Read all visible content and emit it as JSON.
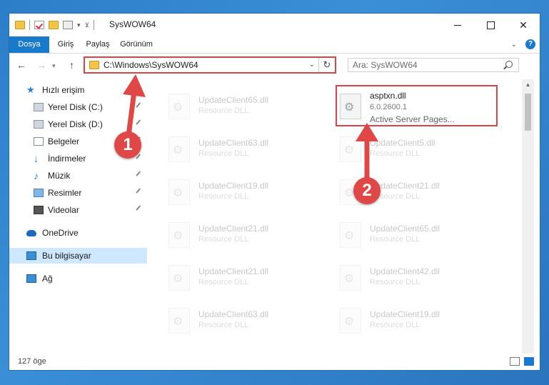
{
  "window": {
    "title": "SysWOW64"
  },
  "ribbon": {
    "tabs": [
      {
        "label": "Dosya"
      },
      {
        "label": "Giriş"
      },
      {
        "label": "Paylaş"
      },
      {
        "label": "Görünüm"
      }
    ],
    "help_label": "?"
  },
  "navbar": {
    "address": "C:\\Windows\\SysWOW64",
    "search_placeholder": "Ara: SysWOW64"
  },
  "navpane": {
    "quick_access": "Hızlı erişim",
    "items": [
      {
        "label": "Yerel Disk (C:)",
        "icon": "drive-icon",
        "pinned": true
      },
      {
        "label": "Yerel Disk (D:)",
        "icon": "drive-icon",
        "pinned": true
      },
      {
        "label": "Belgeler",
        "icon": "documents-icon",
        "pinned": true
      },
      {
        "label": "İndirmeler",
        "icon": "download-icon",
        "pinned": true
      },
      {
        "label": "Müzik",
        "icon": "music-icon",
        "pinned": true
      },
      {
        "label": "Resimler",
        "icon": "pictures-icon",
        "pinned": true
      },
      {
        "label": "Videolar",
        "icon": "videos-icon",
        "pinned": true
      }
    ],
    "onedrive": "OneDrive",
    "this_pc": "Bu bilgisayar",
    "network": "Ağ"
  },
  "files": {
    "highlighted": {
      "name": "asptxn.dll",
      "version": "6.0.2600.1",
      "description": "Active Server Pages..."
    },
    "left_column": [
      {
        "name": "UpdateClient65.dll",
        "type": "Resource DLL"
      },
      {
        "name": "UpdateClient63.dll",
        "type": "Resource DLL"
      },
      {
        "name": "UpdateClient19.dll",
        "type": "Resource DLL"
      },
      {
        "name": "UpdateClient21.dll",
        "type": "Resource DLL"
      },
      {
        "name": "UpdateClient21.dll",
        "type": "Resource DLL"
      },
      {
        "name": "UpdateClient63.dll",
        "type": "Resource DLL"
      }
    ],
    "right_column": [
      {
        "name": "UpdateClient5.dll",
        "type": "Resource DLL"
      },
      {
        "name": "UpdateClient21.dll",
        "type": "Resource DLL"
      },
      {
        "name": "UpdateClient65.dll",
        "type": "Resource DLL"
      },
      {
        "name": "UpdateClient42.dll",
        "type": "Resource DLL"
      },
      {
        "name": "UpdateClient19.dll",
        "type": "Resource DLL"
      }
    ]
  },
  "status": {
    "item_count": "127 öge"
  },
  "annotations": {
    "marker1": "1",
    "marker2": "2",
    "color": "#e04848"
  }
}
